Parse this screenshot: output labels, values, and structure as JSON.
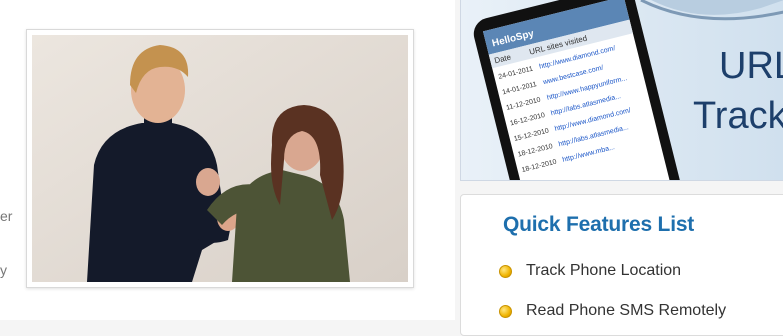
{
  "left_column": {
    "cut_text_1": "er",
    "cut_text_2": "y",
    "photo_alt": "man-restraining-woman-photo"
  },
  "banner": {
    "phone": {
      "app_name": "HelloSpy",
      "columns": [
        "Date",
        "URL sites visited"
      ],
      "rows": [
        {
          "date": "24-01-2011",
          "url": "http://www.diamond.com/"
        },
        {
          "date": "14-01-2011",
          "url": "www.bestcase.com/"
        },
        {
          "date": "11-12-2010",
          "url": "http://www.happyuniform..."
        },
        {
          "date": "16-12-2010",
          "url": "http://labs.atlasmedia..."
        },
        {
          "date": "15-12-2010",
          "url": "http://www.diamond.com/"
        },
        {
          "date": "18-12-2010",
          "url": "http://labs.atlasmedia..."
        },
        {
          "date": "18-12-2010",
          "url": "http://www.mba..."
        }
      ]
    },
    "headline_line1": "URL",
    "headline_line2": "Track"
  },
  "quick_features": {
    "title": "Quick Features List",
    "items": [
      {
        "label": "Track Phone Location",
        "icon": "bullet-icon"
      },
      {
        "label": "Read Phone SMS Remotely",
        "icon": "bullet-icon"
      }
    ]
  },
  "colors": {
    "title_blue": "#1e6fad",
    "bullet_yellow": "#f0b400",
    "banner_blue": "#dbe8f4"
  }
}
